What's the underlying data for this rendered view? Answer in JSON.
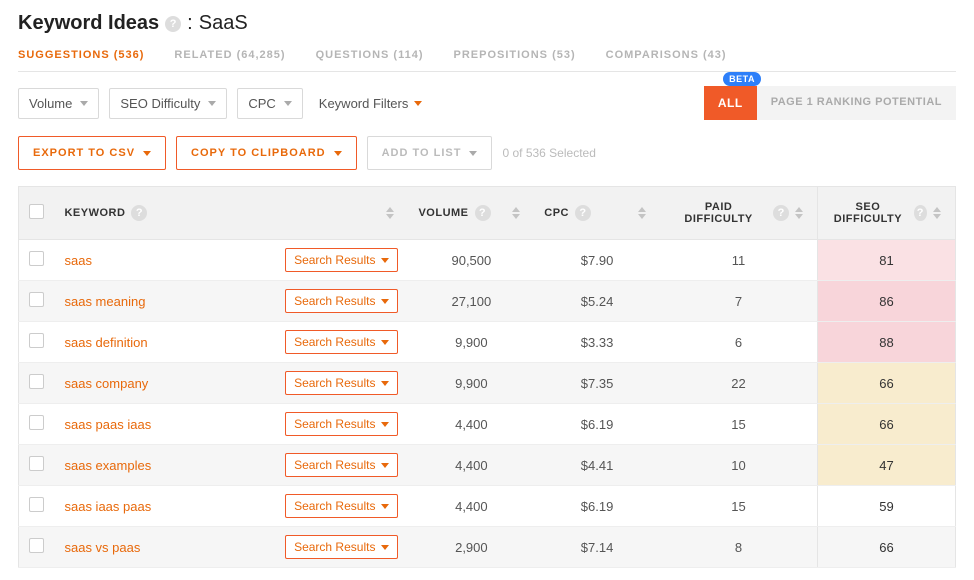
{
  "title": {
    "main": "Keyword Ideas",
    "term": "SaaS"
  },
  "tabs": [
    {
      "label": "SUGGESTIONS (536)",
      "active": true
    },
    {
      "label": "RELATED (64,285)"
    },
    {
      "label": "QUESTIONS (114)"
    },
    {
      "label": "PREPOSITIONS (53)"
    },
    {
      "label": "COMPARISONS (43)"
    }
  ],
  "filters": {
    "volume": "Volume",
    "seo_diff": "SEO Difficulty",
    "cpc": "CPC",
    "keyword_filters": "Keyword Filters"
  },
  "segments": {
    "beta": "BETA",
    "all": "ALL",
    "potential": "PAGE 1 RANKING POTENTIAL"
  },
  "actions": {
    "export": "EXPORT TO CSV",
    "copy": "COPY TO CLIPBOARD",
    "addlist": "ADD TO LIST",
    "selected": "0 of 536 Selected"
  },
  "columns": {
    "keyword": "KEYWORD",
    "volume": "VOLUME",
    "cpc": "CPC",
    "paid_diff": "PAID DIFFICULTY",
    "seo_diff": "SEO DIFFICULTY",
    "search_results": "Search Results"
  },
  "chart_data": {
    "type": "table",
    "columns": [
      "keyword",
      "volume",
      "cpc",
      "paid_difficulty",
      "seo_difficulty"
    ],
    "rows": [
      {
        "keyword": "saas",
        "volume": "90,500",
        "cpc": "$7.90",
        "paid_diff": "11",
        "seo_diff": "81",
        "seo_color": "#fae1e4"
      },
      {
        "keyword": "saas meaning",
        "volume": "27,100",
        "cpc": "$5.24",
        "paid_diff": "7",
        "seo_diff": "86",
        "seo_color": "#f8d5da"
      },
      {
        "keyword": "saas definition",
        "volume": "9,900",
        "cpc": "$3.33",
        "paid_diff": "6",
        "seo_diff": "88",
        "seo_color": "#f8d5da"
      },
      {
        "keyword": "saas company",
        "volume": "9,900",
        "cpc": "$7.35",
        "paid_diff": "22",
        "seo_diff": "66",
        "seo_color": "#f8ecce"
      },
      {
        "keyword": "saas paas iaas",
        "volume": "4,400",
        "cpc": "$6.19",
        "paid_diff": "15",
        "seo_diff": "66",
        "seo_color": "#f8ecce"
      },
      {
        "keyword": "saas examples",
        "volume": "4,400",
        "cpc": "$4.41",
        "paid_diff": "10",
        "seo_diff": "47",
        "seo_color": "#f8ecce"
      },
      {
        "keyword": "saas iaas paas",
        "volume": "4,400",
        "cpc": "$6.19",
        "paid_diff": "15",
        "seo_diff": "59",
        "seo_color": "#ffffff"
      },
      {
        "keyword": "saas vs paas",
        "volume": "2,900",
        "cpc": "$7.14",
        "paid_diff": "8",
        "seo_diff": "66",
        "seo_color": "#f6f6f6"
      }
    ]
  }
}
